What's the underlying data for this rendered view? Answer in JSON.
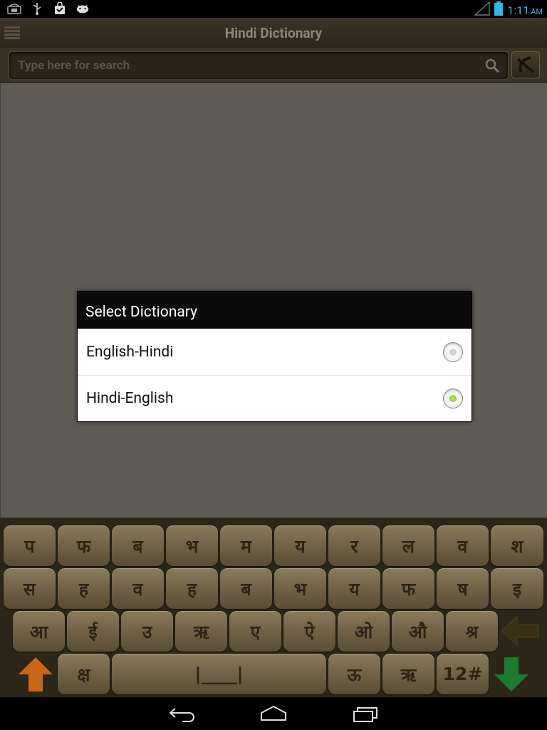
{
  "status_bar": {
    "icons": [
      "phone-icon",
      "usb-icon",
      "shopping-bag-icon",
      "android-debug-icon"
    ],
    "signal_icon": "signal-icon",
    "battery_icon": "battery-icon",
    "time": "1:11",
    "ampm": "AM"
  },
  "app": {
    "title": "Hindi Dictionary",
    "menu_icon": "menu-icon"
  },
  "search": {
    "placeholder": "Type here for search",
    "value": "",
    "search_icon": "search-icon",
    "toggle_icon": "swap-dictionary-icon"
  },
  "dialog": {
    "title": "Select Dictionary",
    "options": [
      {
        "label": "English-Hindi",
        "selected": false
      },
      {
        "label": "Hindi-English",
        "selected": true
      }
    ]
  },
  "keyboard": {
    "row1": [
      "प",
      "फ",
      "ब",
      "भ",
      "म",
      "य",
      "र",
      "ल",
      "व",
      "श"
    ],
    "row2": [
      "स",
      "ह",
      "व",
      "ह",
      "ब",
      "भ",
      "य",
      "फ",
      "ष",
      "इ"
    ],
    "row3": [
      "आ",
      "ई",
      "उ",
      "ऋ",
      "ए",
      "ऐ",
      "ओ",
      "औ",
      "श्र"
    ],
    "row4": {
      "k1": "क्ष",
      "space": "|____|",
      "k2": "ऊ",
      "k3": "ऋ",
      "numbers": "12#"
    },
    "shift_icon": "shift-up-arrow-icon",
    "backspace_icon": "backspace-arrow-icon",
    "enter_icon": "down-arrow-icon",
    "colors": {
      "shift": "#c8661a",
      "enter": "#1e7a2e",
      "backspace": "#3a3016"
    }
  },
  "nav_bar": {
    "back_icon": "back-icon",
    "home_icon": "home-icon",
    "recents_icon": "recent-apps-icon"
  }
}
